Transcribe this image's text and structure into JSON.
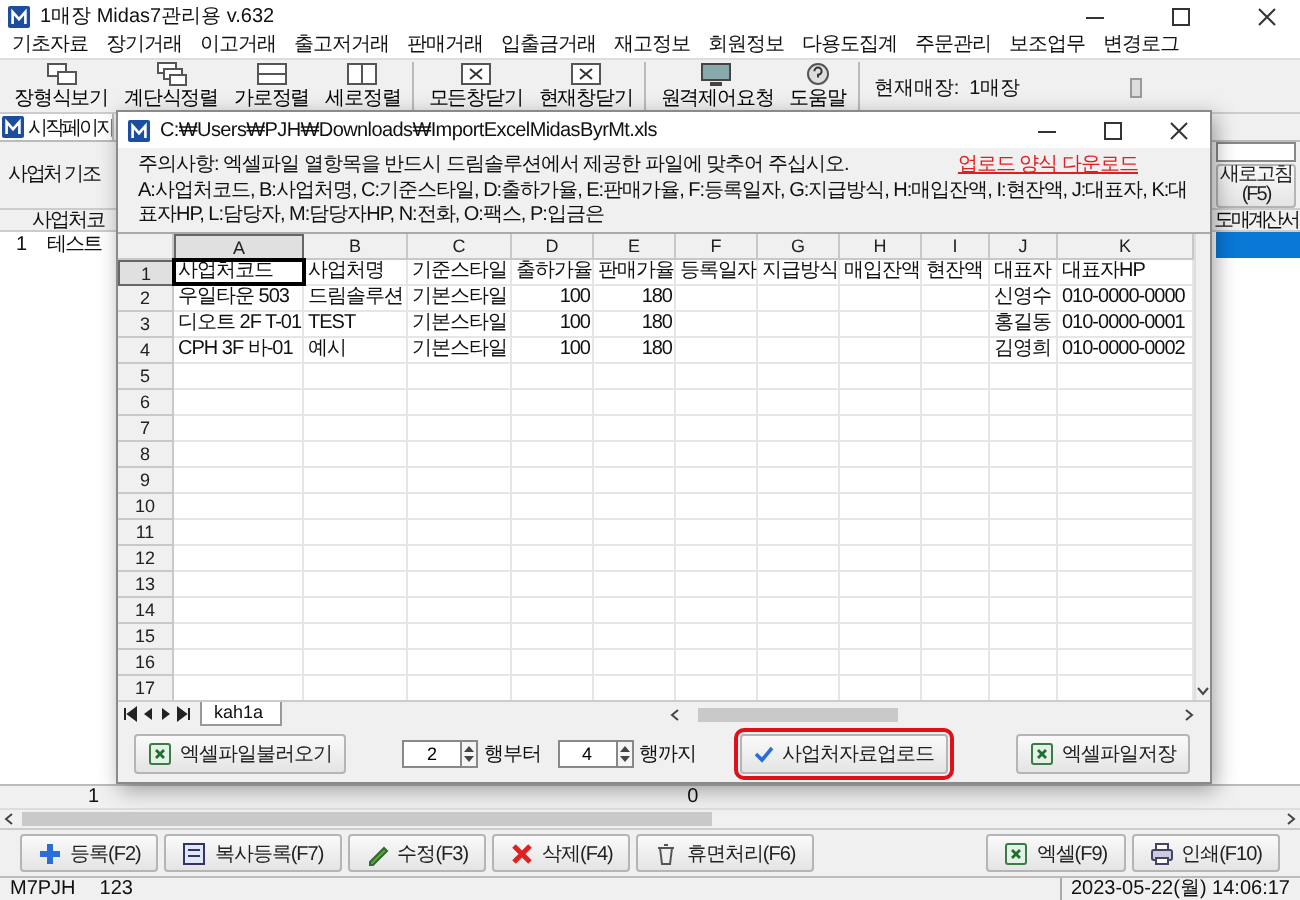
{
  "window": {
    "title": "1매장 Midas7관리용 v.632"
  },
  "menu": [
    "기초자료",
    "장기거래",
    "이고거래",
    "출고저거래",
    "판매거래",
    "입출금거래",
    "재고정보",
    "회원정보",
    "다용도집계",
    "주문관리",
    "보조업무",
    "변경로그"
  ],
  "toolbar": {
    "groups": [
      [
        {
          "label": "장형식보기",
          "kind": "layout"
        },
        {
          "label": "계단식정렬",
          "kind": "cascade"
        },
        {
          "label": "가로정렬",
          "kind": "horizontal"
        },
        {
          "label": "세로정렬",
          "kind": "vertical"
        }
      ],
      [
        {
          "label": "모든창닫기",
          "kind": "close"
        },
        {
          "label": "현재창닫기",
          "kind": "close"
        }
      ],
      [
        {
          "label": "원격제어요청",
          "kind": "remote"
        },
        {
          "label": "도움말",
          "kind": "help"
        }
      ]
    ],
    "store_label": "현재매장:",
    "store_value": "1매장"
  },
  "tabs": [
    {
      "label": "시작페이지",
      "selected": true
    }
  ],
  "filter": {
    "label": "사업처 기조",
    "refresh_button": "새로고침(F5)"
  },
  "list": {
    "columns": [
      "사업처코",
      "도매계산서"
    ],
    "rows": [
      {
        "number": "1",
        "name": "테스트",
        "selected": true
      }
    ],
    "footer": [
      "1",
      "0"
    ]
  },
  "actions": {
    "left": [
      {
        "label": "등록(F2)",
        "kind": "add"
      },
      {
        "label": "복사등록(F7)",
        "kind": "copy"
      },
      {
        "label": "수정(F3)",
        "kind": "edit"
      },
      {
        "label": "삭제(F4)",
        "kind": "delete"
      },
      {
        "label": "휴면처리(F6)",
        "kind": "dormant"
      }
    ],
    "right": [
      {
        "label": "엑셀(F9)",
        "kind": "excel"
      },
      {
        "label": "인쇄(F10)",
        "kind": "print"
      }
    ]
  },
  "status_bar": {
    "user": "M7PJH",
    "code": "123",
    "datetime": "2023-05-22(월) 14:06:17"
  },
  "dialog": {
    "title": "C:₩Users₩PJH₩Downloads₩ImportExcelMidasByrMt.xls",
    "notice": "주의사항: 엑셀파일 열항목을 반드시 드림솔루션에서 제공한 파일에 맞추어 주십시오.",
    "download_link": "업로드 양식 다운로드",
    "column_help": "A:사업처코드, B:사업처명, C:기준스타일, D:출하가율, E:판매가율, F:등록일자, G:지급방식, H:매입잔액, I:현잔액, J:대표자, K:대표자HP, L:담당자, M:담당자HP, N:전화, O:팩스, P:입금은",
    "sheet": {
      "columns": [
        {
          "letter": "A",
          "selected": true,
          "numeric": false
        },
        {
          "letter": "B",
          "selected": false,
          "numeric": false
        },
        {
          "letter": "C",
          "selected": false,
          "numeric": false
        },
        {
          "letter": "D",
          "selected": false,
          "numeric": true
        },
        {
          "letter": "E",
          "selected": false,
          "numeric": true
        },
        {
          "letter": "F",
          "selected": false,
          "numeric": false
        },
        {
          "letter": "G",
          "selected": false,
          "numeric": false
        },
        {
          "letter": "H",
          "selected": false,
          "numeric": false
        },
        {
          "letter": "I",
          "selected": false,
          "numeric": false
        },
        {
          "letter": "J",
          "selected": false,
          "numeric": false
        },
        {
          "letter": "K",
          "selected": false,
          "numeric": false
        }
      ],
      "rows": [
        {
          "number": "1",
          "selected": true,
          "cells": [
            "사업처코드",
            "사업처명",
            "기준스타일",
            "출하가율",
            "판매가율",
            "등록일자",
            "지급방식",
            "매입잔액",
            "현잔액",
            "대표자",
            "대표자HP"
          ]
        },
        {
          "number": "2",
          "selected": false,
          "cells": [
            "우일타운 503",
            "드림솔루션",
            "기본스타일",
            "100",
            "180",
            null,
            null,
            null,
            null,
            "신영수",
            "010-0000-0000"
          ]
        },
        {
          "number": "3",
          "selected": false,
          "cells": [
            "디오트 2F T-01",
            "TEST",
            "기본스타일",
            "100",
            "180",
            null,
            null,
            null,
            null,
            "홍길동",
            "010-0000-0001"
          ]
        },
        {
          "number": "4",
          "selected": false,
          "cells": [
            "CPH 3F 바-01",
            "예시",
            "기본스타일",
            "100",
            "180",
            null,
            null,
            null,
            null,
            "김영희",
            "010-0000-0002"
          ]
        },
        {
          "number": "5",
          "selected": false
        },
        {
          "number": "6",
          "selected": false
        },
        {
          "number": "7",
          "selected": false
        },
        {
          "number": "8",
          "selected": false
        },
        {
          "number": "9",
          "selected": false
        },
        {
          "number": "10",
          "selected": false
        },
        {
          "number": "11",
          "selected": false
        },
        {
          "number": "12",
          "selected": false
        },
        {
          "number": "13",
          "selected": false
        },
        {
          "number": "14",
          "selected": false
        },
        {
          "number": "15",
          "selected": false
        },
        {
          "number": "16",
          "selected": false
        },
        {
          "number": "17",
          "selected": false
        }
      ],
      "sheet_tab": "kah1a"
    },
    "load_button": {
      "label": "엑셀파일불러오기",
      "highlighted": false
    },
    "from_row": "2",
    "from_label": "행부터",
    "to_row": "4",
    "to_label": "행까지",
    "upload_button": {
      "label": "사업처자료업로드",
      "highlighted": true
    },
    "save_button": {
      "label": "엑셀파일저장",
      "highlighted": false
    }
  }
}
